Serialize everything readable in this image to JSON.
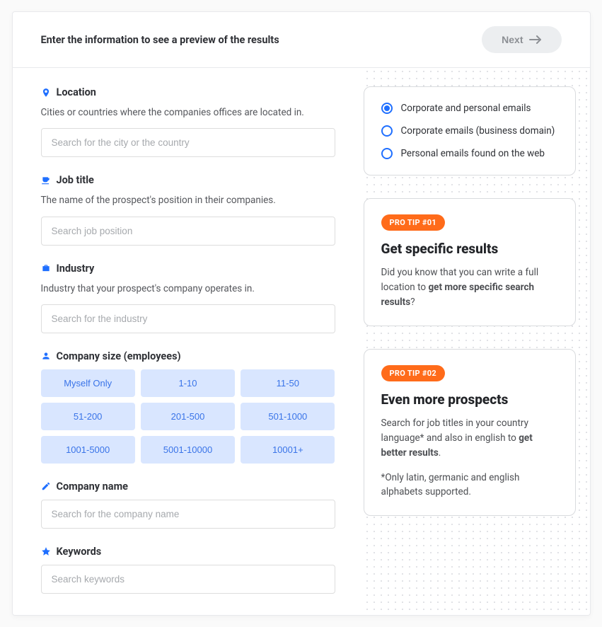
{
  "header": {
    "title": "Enter the information to see a preview of the results",
    "next_label": "Next"
  },
  "fields": {
    "location": {
      "label": "Location",
      "desc": "Cities or countries where the companies offices are located in.",
      "placeholder": "Search for the city or the country"
    },
    "job_title": {
      "label": "Job title",
      "desc": "The name of the prospect's position in their companies.",
      "placeholder": "Search job position"
    },
    "industry": {
      "label": "Industry",
      "desc": "Industry that your prospect's company operates in.",
      "placeholder": "Search for the industry"
    },
    "company_size": {
      "label": "Company size (employees)",
      "options": [
        "Myself Only",
        "1-10",
        "11-50",
        "51-200",
        "201-500",
        "501-1000",
        "1001-5000",
        "5001-10000",
        "10001+"
      ]
    },
    "company_name": {
      "label": "Company name",
      "placeholder": "Search for the company name"
    },
    "keywords": {
      "label": "Keywords",
      "placeholder": "Search keywords"
    }
  },
  "email_options": {
    "items": [
      {
        "label": "Corporate and personal emails",
        "checked": true
      },
      {
        "label": "Corporate emails (business domain)",
        "checked": false
      },
      {
        "label": "Personal emails found on the web",
        "checked": false
      }
    ]
  },
  "tips": [
    {
      "badge": "PRO TIP #01",
      "title": "Get specific results",
      "body_pre": "Did you know that you can write a full location to ",
      "body_strong": "get more specific search results",
      "body_post": "?"
    },
    {
      "badge": "PRO TIP #02",
      "title": "Even more prospects",
      "body_pre": "Search for job titles in your country language* and also in english to ",
      "body_strong": "get better results",
      "body_post": ".",
      "note": "*Only latin, germanic and english alphabets supported."
    }
  ]
}
